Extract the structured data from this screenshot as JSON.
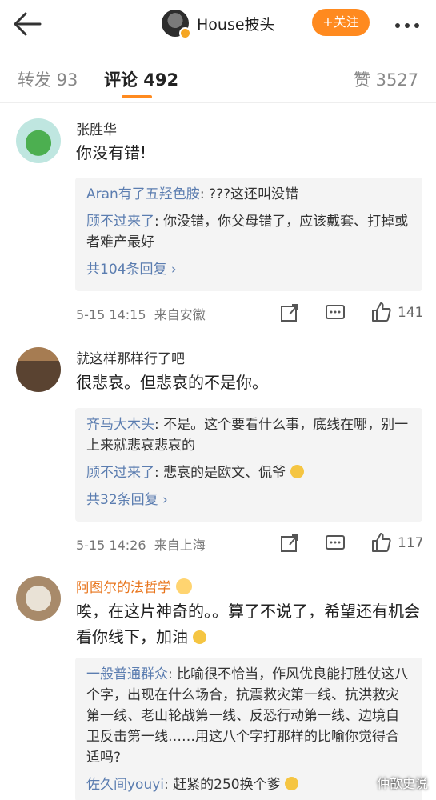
{
  "header": {
    "user_name": "House披头",
    "follow_label": "+关注"
  },
  "tabs": [
    {
      "label": "转发 93"
    },
    {
      "label": "评论 492"
    },
    {
      "label": "赞 3527"
    }
  ],
  "comments": [
    {
      "user": "张胜华",
      "text": "你没有错!",
      "replies": [
        {
          "who": "Aran有了五羟色胺",
          "text": ": ???这还叫没错"
        },
        {
          "who": "顾不过来了",
          "text": ": 你没错，你父母错了，应该戴套、打掉或者难产最好"
        }
      ],
      "more_replies": "共104条回复 ›",
      "time": "5-15 14:15",
      "source": "来自安徽",
      "likes": "141"
    },
    {
      "user": "就这样那样行了吧",
      "text": "很悲哀。但悲哀的不是你。",
      "replies": [
        {
          "who": "齐马大木头",
          "text": ": 不是。这个要看什么事，底线在哪，别一上来就悲哀悲哀的"
        },
        {
          "who": "顾不过来了",
          "text": ": 悲哀的是欧文、侃爷"
        }
      ],
      "more_replies": "共32条回复 ›",
      "time": "5-15 14:26",
      "source": "来自上海",
      "likes": "117"
    },
    {
      "user": "阿图尔的法哲学",
      "text": "唉，在这片神奇的。。算了不说了，希望还有机会看你线下，加油",
      "replies": [
        {
          "who": "一般普通群众",
          "text": ": 比喻很不恰当，作风优良能打胜仗这八个字，出现在什么场合，抗震救灾第一线、抗洪救灾第一线、老山轮战第一线、反恐行动第一线、边境自卫反击第一线……用这八个字打那样的比喻你觉得合适吗?"
        },
        {
          "who": "佐久间youyi",
          "text": ": 赶紧的250换个爹"
        }
      ]
    }
  ],
  "watermark": "仲歆史说"
}
